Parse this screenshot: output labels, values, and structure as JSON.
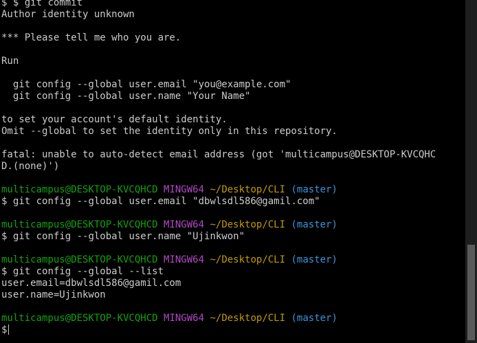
{
  "top_partial": "$ git commit",
  "output": [
    "Author identity unknown",
    "",
    "*** Please tell me who you are.",
    "",
    "Run",
    "",
    "  git config --global user.email \"you@example.com\"",
    "  git config --global user.name \"Your Name\"",
    "",
    "to set your account's default identity.",
    "Omit --global to set the identity only in this repository.",
    "",
    "fatal: unable to auto-detect email address (got 'multicampus@DESKTOP-KVCQHC",
    "D.(none)')"
  ],
  "prompt": {
    "user_host": "multicampus@DESKTOP-KVCQHCD",
    "system": "MINGW64",
    "path": "~/Desktop/CLI",
    "branch": "(master)",
    "symbol": "$"
  },
  "commands": [
    {
      "command": "git config --global user.email \"dbwlsdl586@gamil.com\"",
      "output": []
    },
    {
      "command": "git config --global user.name \"Ujinkwon\"",
      "output": []
    },
    {
      "command": "git config --global --list",
      "output": [
        "user.email=dbwlsdl586@gamil.com",
        "user.name=Ujinkwon"
      ]
    }
  ],
  "colors": {
    "background": "#000000",
    "text": "#cccccc",
    "user_host": "#13a10e",
    "system": "#b148c6",
    "path": "#c19c00",
    "branch": "#3a96dd"
  }
}
